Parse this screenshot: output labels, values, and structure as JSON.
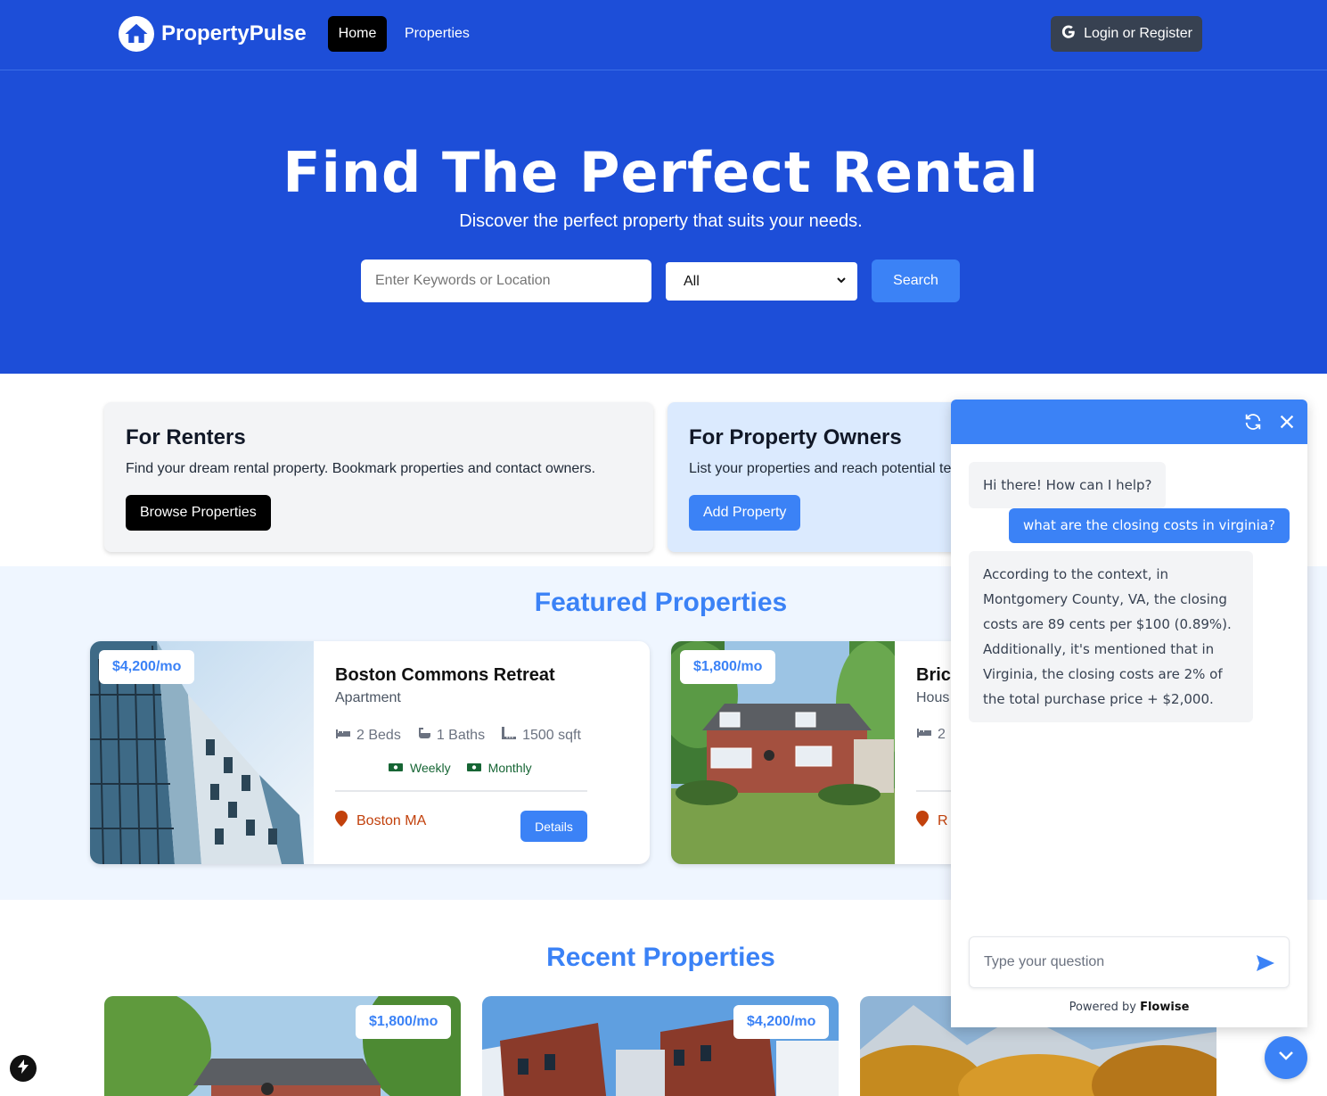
{
  "nav": {
    "brand": "PropertyPulse",
    "home_label": "Home",
    "properties_label": "Properties",
    "login_label": "Login or Register"
  },
  "hero": {
    "title": "Find The Perfect Rental",
    "subtitle": "Discover the perfect property that suits your needs.",
    "search_placeholder": "Enter Keywords or Location",
    "select_value": "All",
    "search_button": "Search"
  },
  "info_cards": {
    "renters": {
      "title": "For Renters",
      "text": "Find your dream rental property. Bookmark properties and contact owners.",
      "button": "Browse Properties"
    },
    "owners": {
      "title": "For Property Owners",
      "text": "List your properties and reach potential te",
      "button": "Add Property"
    }
  },
  "featured": {
    "title": "Featured Properties",
    "cards": [
      {
        "price": "$4,200/mo",
        "name": "Boston Commons Retreat",
        "type": "Apartment",
        "beds": "2 Beds",
        "baths": "1 Baths",
        "sqft": "1500 sqft",
        "rate1": "Weekly",
        "rate2": "Monthly",
        "location": "Boston MA",
        "details": "Details"
      },
      {
        "price": "$1,800/mo",
        "name": "Bric",
        "type": "Hous",
        "beds": "2",
        "location": "R"
      }
    ]
  },
  "recent": {
    "title": "Recent Properties",
    "cards": [
      {
        "price": "$1,800/mo"
      },
      {
        "price": "$4,200/mo"
      }
    ]
  },
  "chat": {
    "messages": [
      {
        "role": "bot",
        "text": "Hi there! How can I help?"
      },
      {
        "role": "user",
        "text": "what are the closing costs in virginia?"
      },
      {
        "role": "bot",
        "text": "According to the context, in Montgomery County, VA, the closing costs are 89 cents per $100 (0.89%). Additionally, it's mentioned that in Virginia, the closing costs are 2% of the total purchase price + $2,000."
      }
    ],
    "input_placeholder": "Type your question",
    "powered_prefix": "Powered by",
    "powered_brand": "Flowise"
  },
  "colors": {
    "primary": "#1d4ed8",
    "accent": "#3b82f6",
    "location": "#c2410c",
    "rates": "#166534"
  },
  "icons": [
    "home-icon",
    "google-icon",
    "bed-icon",
    "bath-icon",
    "ruler-icon",
    "money-icon",
    "map-pin-icon",
    "refresh-icon",
    "close-icon",
    "send-icon",
    "chevron-down-icon",
    "bolt-icon"
  ]
}
